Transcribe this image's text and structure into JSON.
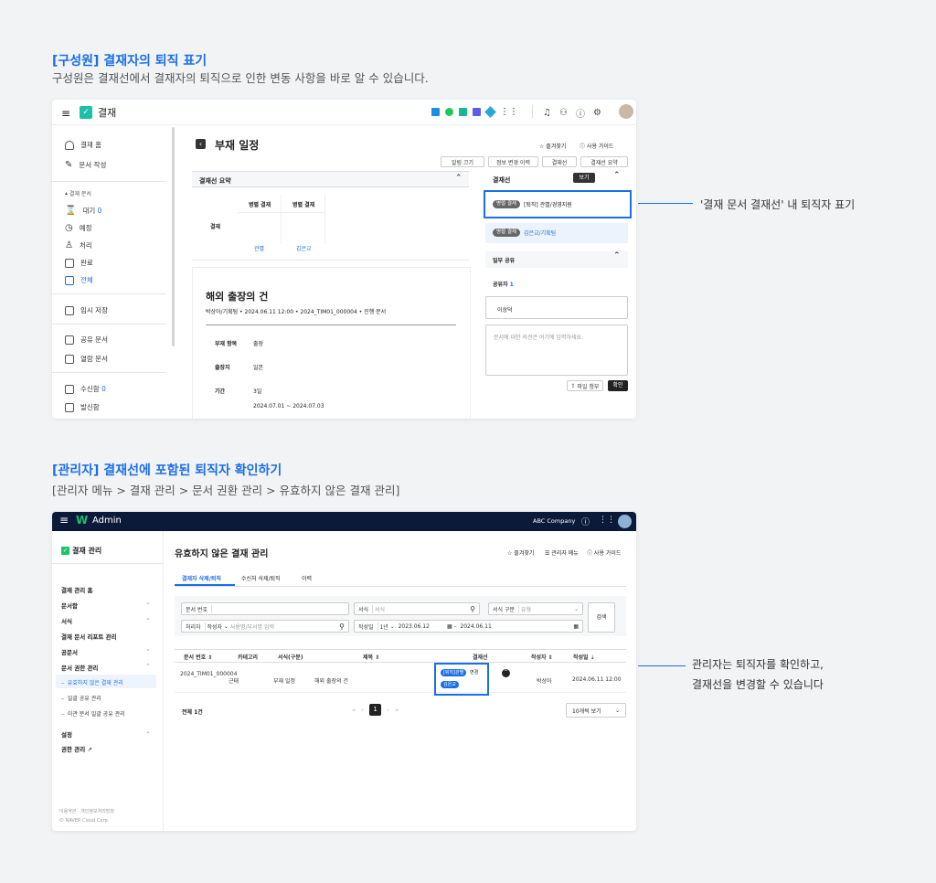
{
  "section1": {
    "title": "[구성원] 결재자의 퇴직 표기",
    "subtitle": "구성원은 결재선에서 결재자의 퇴직으로 인한 변동 사항을 바로 알 수 있습니다.",
    "callout": "'결재 문서 결재선' 내 퇴직자 표기"
  },
  "app1": {
    "app_title": "결재",
    "sidebar": {
      "home": "결재 홈",
      "compose": "문서 작성",
      "group": "결재 문서",
      "waiting": "대기",
      "waiting_count": "0",
      "scheduled": "예정",
      "process": "처리",
      "done": "완료",
      "all": "전체",
      "temp": "임시 저장",
      "shared": "공유 문서",
      "viewed": "열람 문서",
      "inbox": "수신함",
      "inbox_count": "0",
      "sent": "발신함"
    },
    "doc_title": "부재 일정",
    "fav": "즐겨찾기",
    "guide": "사용 가이드",
    "toolbar": [
      "알림 끄기",
      "정보 변경 이력",
      "결재선",
      "결재선 요약"
    ],
    "summary_label": "결재선 요약",
    "approval_headers": [
      "병렬 결재",
      "병렬 결재"
    ],
    "approval_row_label": "결재",
    "approvers": [
      "관별",
      "김은교"
    ],
    "subject": "해외 출장의 건",
    "meta": "박상아/기획팀  •  2024.06.11 12:00  •  2024_TIM01_000004  •  진행 문서",
    "fields": [
      {
        "k": "부재 항목",
        "v": "출장"
      },
      {
        "k": "출장지",
        "v": "일본"
      },
      {
        "k": "기간",
        "v": "3일"
      }
    ],
    "period": "2024.07.01 ~ 2024.07.03",
    "panel_title": "결재선",
    "view_btn": "보기",
    "line1_tag": "병렬 결재",
    "line1_text": "[퇴직] 관별/경영지원",
    "line2_tag": "병렬 결재",
    "line2_text": "김은교/기획팀",
    "partial_share": "일부 공유",
    "sharer_label": "공유자",
    "sharer_count": "1",
    "sharer_name": "이상덕",
    "comment_ph": "문서에 대한 의견은 여기에 입력하세요.",
    "attach": "파일 첨부",
    "confirm": "확인"
  },
  "section2": {
    "title": "[관리자] 결재선에 포함된 퇴직자 확인하기",
    "subtitle": "[관리자 메뉴 > 결재 관리 > 문서 권환 관리 > 유효하지 않은 결재 관리]",
    "callout1": "관리자는 퇴직자를 확인하고,",
    "callout2": "결재선을 변경할 수 있습니다"
  },
  "app2": {
    "app_title": "Admin",
    "company": "ABC Company",
    "side_title": "결재 관리",
    "menu": [
      "결재 관리 홈",
      "문서함",
      "서식",
      "결재 문서 리포트 관리",
      "공문서",
      "문서 권한 관리"
    ],
    "submenu": [
      "유효하지 않은 결재 관리",
      "일괄 공유 관리",
      "이관 문서 일괄 공유 관리"
    ],
    "menu2": [
      "설정",
      "권한 관리"
    ],
    "footer1": "이용약관 · 개인정보처리방침",
    "footer2": "© NAVER Cloud Corp.",
    "page_title": "유효하지 않은 결재 관리",
    "fav": "즐겨찾기",
    "admin_menu": "관리자 메뉴",
    "guide": "사용 가이드",
    "tabs": [
      "결재자 삭제/퇴직",
      "수신처 삭제/퇴직",
      "이력"
    ],
    "filters": {
      "doc_no": "문서 번호",
      "form": "서식",
      "form_ph": "서식",
      "form_type": "서식 구분",
      "form_type_ph": "유형",
      "handler": "처리자",
      "author": "작성자",
      "author_ph": "사용명/부서명 입력",
      "date": "작성일",
      "period": "1년",
      "date_from": "2023.06.12",
      "date_to": "2024.06.11",
      "search": "검색"
    },
    "columns": [
      "문서 번호",
      "카테고리",
      "서식(구분)",
      "제목",
      "결재선",
      "작성자",
      "작성일"
    ],
    "row": {
      "doc_no": "2024_TIM01_000004",
      "category": "근태",
      "form": "부재 일정",
      "title": "해외 출장의 건",
      "tag1": "[퇴직]관별",
      "change": "변경",
      "tag2": "김은교",
      "author": "박상아",
      "date": "2024.06.11 12:00"
    },
    "total": "전체 1건",
    "page": "1",
    "page_size": "10개씩 보기"
  }
}
